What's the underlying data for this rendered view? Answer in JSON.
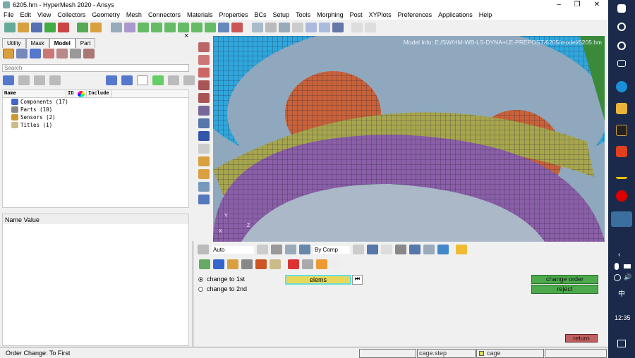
{
  "window": {
    "title": "6205.hm - HyperMesh 2020 - Ansys",
    "minimize": "–",
    "maximize": "❐",
    "close": "✕"
  },
  "menu": [
    "File",
    "Edit",
    "View",
    "Collectors",
    "Geometry",
    "Mesh",
    "Connectors",
    "Materials",
    "Properties",
    "BCs",
    "Setup",
    "Tools",
    "Morphing",
    "Post",
    "XYPlots",
    "Preferences",
    "Applications",
    "Help"
  ],
  "left_panel": {
    "tabs": [
      "Utility",
      "Mask",
      "Model",
      "Part"
    ],
    "active_tab": "Model",
    "close": "×",
    "search_placeholder": "Search",
    "columns": [
      "Name",
      "ID",
      "Include"
    ],
    "tree": [
      "Components (17)",
      "Parts (10)",
      "Sensors (2)",
      "Titles (1)"
    ],
    "props_header": "Name Value"
  },
  "viewport": {
    "model_info": "Model Info: E:/SW/HM-WB-LS-DYNA+LE-PREPOST/6205/model/6205.hm",
    "axis_y": "Y",
    "axis_z": "Z",
    "axis_x": "X"
  },
  "lower_toolbar": {
    "display_mode": "Auto",
    "color_mode": "By Comp"
  },
  "panel": {
    "radio1": "change to 1st",
    "radio2": "change to 2nd",
    "selected": "change to 1st",
    "elems": "elems",
    "reset": "⏮",
    "change_order": "change order",
    "reject": "reject",
    "return": "return"
  },
  "status": {
    "message": "Order Change: To First",
    "field2": "cage.step",
    "field3": "cage"
  },
  "taskbar": {
    "time": "12:35",
    "ime": "中"
  }
}
